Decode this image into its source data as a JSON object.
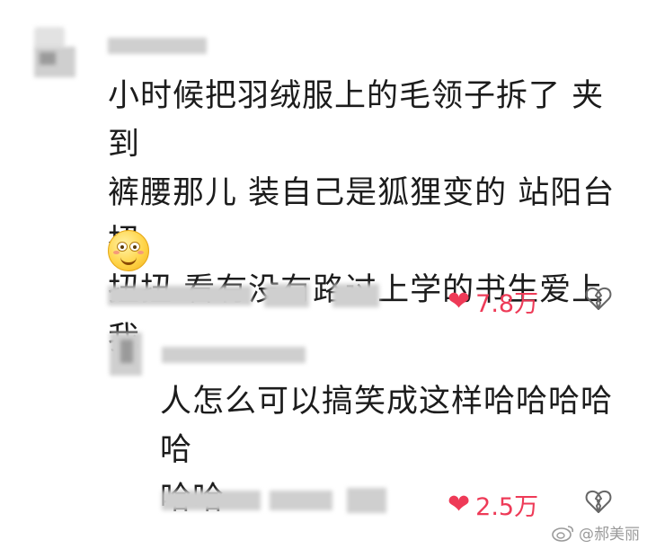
{
  "comments": [
    {
      "text_lines": [
        "小时候把羽绒服上的毛领子拆了 夹到",
        "裤腰那儿 装自己是狐狸变的 站阳台扭",
        "扭扭 看有没有路过上学的书生爱上我"
      ],
      "emoji": "smiling-face-emoji",
      "likes": "7.8万"
    }
  ],
  "replies": [
    {
      "text_lines": [
        "人怎么可以搞笑成这样哈哈哈哈哈",
        "哈哈"
      ],
      "likes": "2.5万"
    }
  ],
  "watermark": "@郝美丽",
  "colors": {
    "like_red": "#ee3a57",
    "text": "#1c1c1c",
    "muted": "#9a9a9a"
  },
  "icons": {
    "like": "heart-icon",
    "dislike": "broken-heart-icon",
    "weibo": "weibo-logo-icon"
  }
}
